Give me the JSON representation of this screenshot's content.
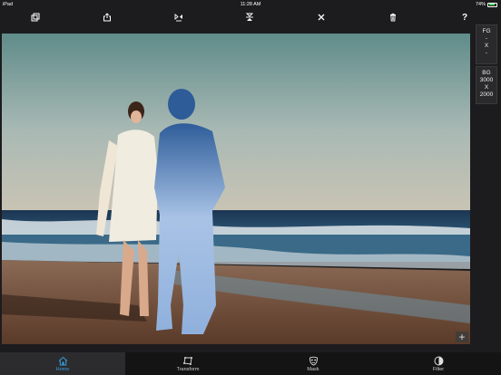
{
  "status_bar": {
    "carrier": "iPad",
    "time": "11:28 AM",
    "battery": "74%",
    "battery_level": 0.74
  },
  "toolbar": {
    "buttons": [
      {
        "icon": "copy-layers-icon"
      },
      {
        "icon": "share-icon"
      },
      {
        "icon": "flip-horizontal-icon"
      },
      {
        "icon": "flip-vertical-icon"
      },
      {
        "icon": "tools-icon"
      },
      {
        "icon": "trash-icon"
      },
      {
        "icon": "help-icon",
        "label": "?"
      }
    ]
  },
  "side_panel": {
    "fg": {
      "title": "FG",
      "line1": "-",
      "line2": "X",
      "line3": "-"
    },
    "bg": {
      "title": "BG",
      "width": "3000",
      "x": "X",
      "height": "2000"
    }
  },
  "canvas": {
    "add_label": "+"
  },
  "tabs": [
    {
      "label": "Home",
      "icon": "home-icon",
      "active": true
    },
    {
      "label": "Transform",
      "icon": "transform-icon",
      "active": false
    },
    {
      "label": "Mask",
      "icon": "mask-icon",
      "active": false
    },
    {
      "label": "Filter",
      "icon": "filter-icon",
      "active": false
    }
  ],
  "colors": {
    "accent": "#3a9bd9",
    "background": "#1c1c1e",
    "tabbar": "#141414"
  }
}
